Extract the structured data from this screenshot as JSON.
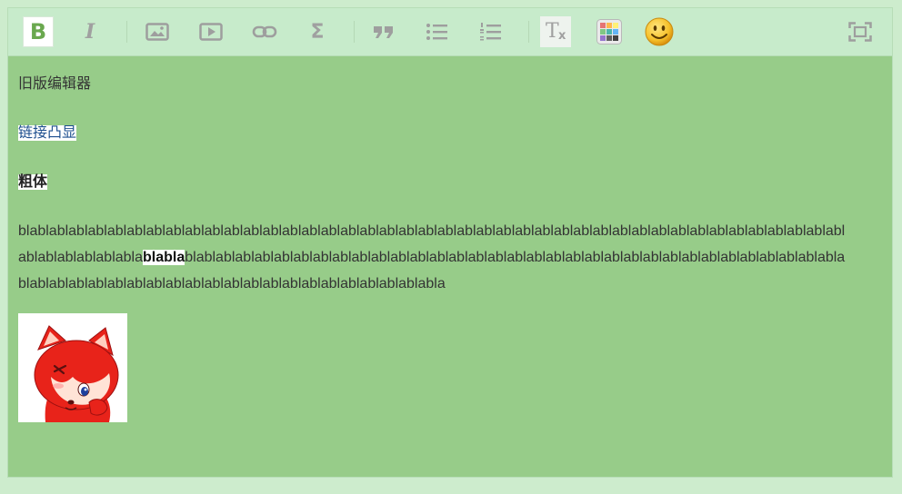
{
  "toolbar": {
    "items": [
      {
        "name": "bold-button",
        "icon": "bold-icon",
        "active": true
      },
      {
        "name": "italic-button",
        "icon": "italic-icon"
      },
      {
        "name": "image-button",
        "icon": "image-icon"
      },
      {
        "name": "video-button",
        "icon": "video-icon"
      },
      {
        "name": "link-button",
        "icon": "link-icon"
      },
      {
        "name": "formula-button",
        "icon": "sigma-icon"
      },
      {
        "name": "quote-button",
        "icon": "quote-icon"
      },
      {
        "name": "bullet-list-button",
        "icon": "bullet-list-icon"
      },
      {
        "name": "numbered-list-button",
        "icon": "numbered-list-icon"
      },
      {
        "name": "clear-format-button",
        "icon": "clear-format-icon"
      },
      {
        "name": "color-button",
        "icon": "color-palette-icon"
      },
      {
        "name": "emoji-button",
        "icon": "smiley-icon"
      },
      {
        "name": "fullscreen-button",
        "icon": "fullscreen-icon"
      }
    ],
    "bold_glyph": "B",
    "italic_glyph": "I",
    "sigma_glyph": "Σ",
    "clear_glyph_main": "T",
    "clear_glyph_sub": "x"
  },
  "content": {
    "paragraph1": "旧版编辑器",
    "link_text": "链接凸显",
    "bold_text": "粗体",
    "para4_before": "blablablablablablablablablablablablablablablablablablablablablablablablablablablablablablablablablablablablablablablablablablablablablablablablabla",
    "para4_bold": "blabla",
    "para4_after": "blablablablablablablablablablablablablablablablablablablablablablablablablablablablablablablablablablablablablablablablablablablablablablablablablablablablablablablabla"
  },
  "colors": {
    "editor_bg": "#97cc89",
    "toolbar_bg": "#c7ebcb",
    "page_bg": "#cdeccd",
    "link": "#1e4f8f",
    "bold_icon": "#6aa84f",
    "icon_gray": "#9e9e9e"
  }
}
